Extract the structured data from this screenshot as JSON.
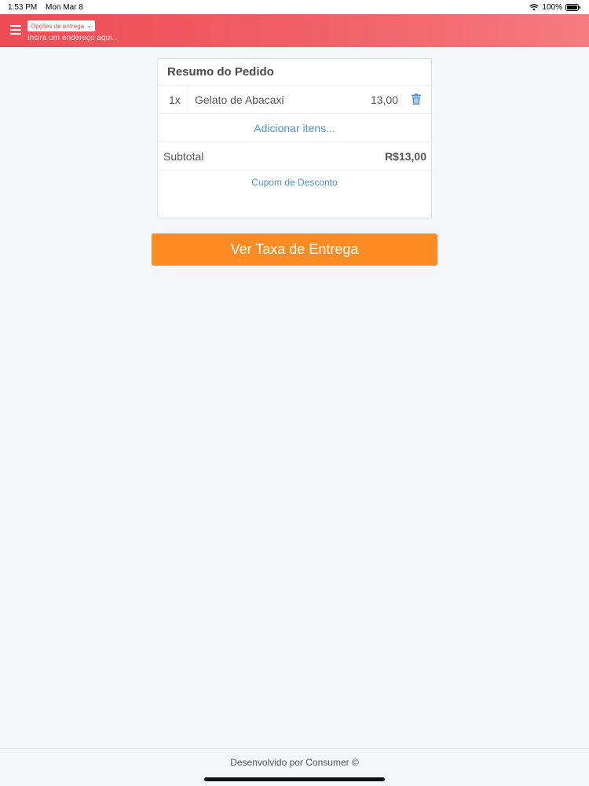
{
  "status_bar": {
    "time": "1:53 PM",
    "date": "Mon Mar 8",
    "battery": "100%"
  },
  "header": {
    "menu_icon": "hamburger-menu-icon",
    "delivery_options_label": "Opções de entrega",
    "address_placeholder": "Insira um endereço aqui...",
    "color": "#ef4b55"
  },
  "summary": {
    "title": "Resumo do Pedido",
    "items": [
      {
        "qty": "1x",
        "name": "Gelato de Abacaxi",
        "price": "13,00",
        "delete_icon": "trash-icon"
      }
    ],
    "add_items_label": "Adicionar itens...",
    "subtotal_label": "Subtotal",
    "subtotal_value": "R$13,00",
    "coupon_label": "Cupom de Desconto"
  },
  "actions": {
    "delivery_fee_label": "Ver Taxa de Entrega",
    "button_color": "#fd8b24"
  },
  "footer": {
    "text": "Desenvolvido por Consumer ©"
  }
}
